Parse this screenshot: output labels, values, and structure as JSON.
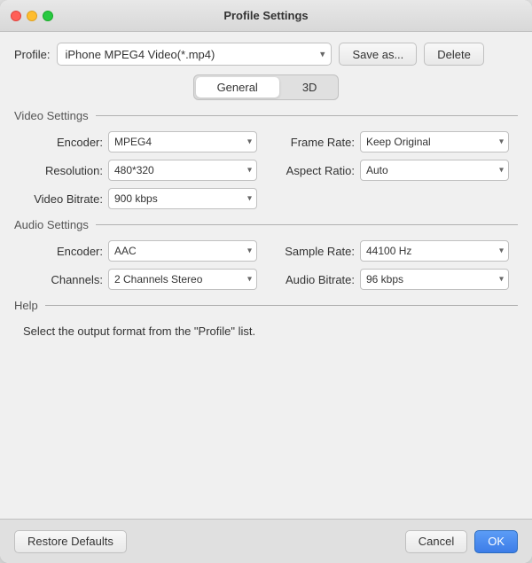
{
  "titleBar": {
    "title": "Profile Settings"
  },
  "profileRow": {
    "label": "Profile:",
    "value": "iPhone MPEG4 Video(*.mp4)",
    "saveAsLabel": "Save as...",
    "deleteLabel": "Delete"
  },
  "tabs": {
    "general": "General",
    "threeD": "3D",
    "activeTab": "general"
  },
  "videoSettings": {
    "sectionTitle": "Video Settings",
    "encoderLabel": "Encoder:",
    "encoderValue": "MPEG4",
    "frameRateLabel": "Frame Rate:",
    "frameRateValue": "Keep Original",
    "resolutionLabel": "Resolution:",
    "resolutionValue": "480*320",
    "aspectRatioLabel": "Aspect Ratio:",
    "aspectRatioValue": "Auto",
    "videoBitrateLabel": "Video Bitrate:",
    "videoBitrateValue": "900 kbps"
  },
  "audioSettings": {
    "sectionTitle": "Audio Settings",
    "encoderLabel": "Encoder:",
    "encoderValue": "AAC",
    "sampleRateLabel": "Sample Rate:",
    "sampleRateValue": "44100 Hz",
    "channelsLabel": "Channels:",
    "channelsValue": "2 Channels Stereo",
    "audioBitrateLabel": "Audio Bitrate:",
    "audioBitrateValue": "96 kbps"
  },
  "help": {
    "sectionTitle": "Help",
    "text": "Select the output format from the \"Profile\" list."
  },
  "footer": {
    "restoreDefaultsLabel": "Restore Defaults",
    "cancelLabel": "Cancel",
    "okLabel": "OK"
  }
}
